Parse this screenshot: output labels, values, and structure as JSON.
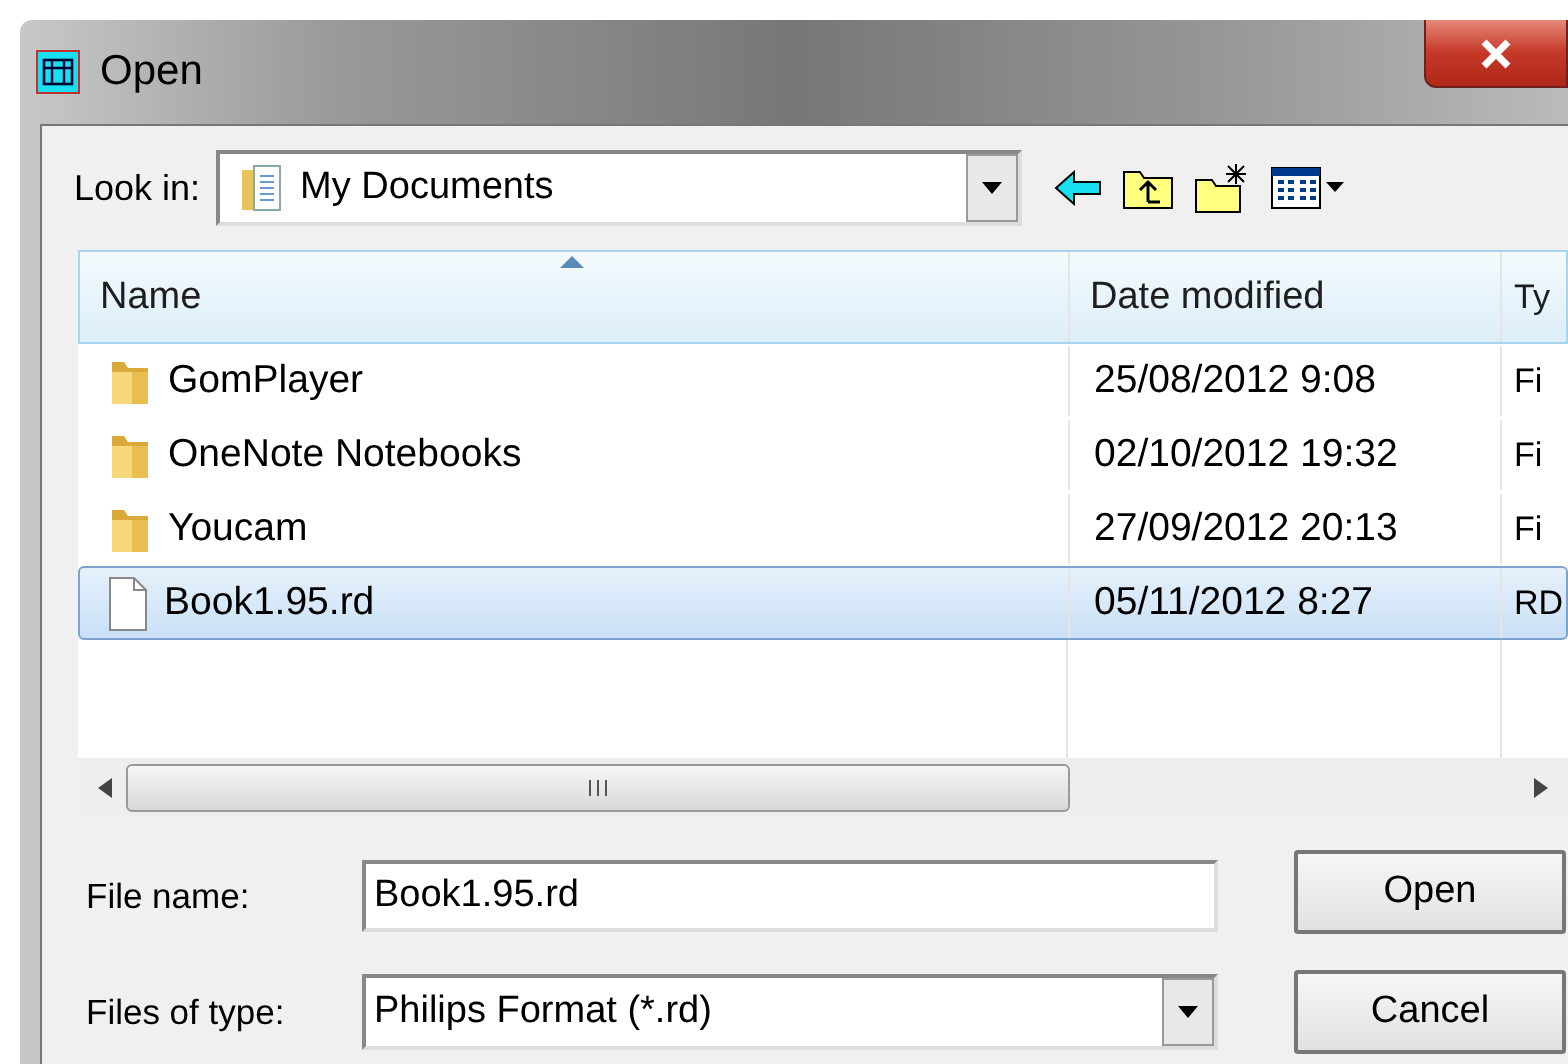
{
  "window": {
    "title": "Open"
  },
  "look_in": {
    "label": "Look in:",
    "value": "My Documents"
  },
  "table": {
    "columns": [
      "Name",
      "Date modified",
      "Ty"
    ],
    "rows": [
      {
        "kind": "folder",
        "name": "GomPlayer",
        "date": "25/08/2012 9:08",
        "column_3": "Fi",
        "selected": false
      },
      {
        "kind": "folder",
        "name": "OneNote Notebooks",
        "date": "02/10/2012 19:32",
        "column_3": "Fi",
        "selected": false
      },
      {
        "kind": "folder",
        "name": "Youcam",
        "date": "27/09/2012 20:13",
        "column_3": "Fi",
        "selected": false
      },
      {
        "kind": "file",
        "name": "Book1.95.rd",
        "date": "05/11/2012 8:27",
        "column_3": "RD",
        "selected": true
      }
    ]
  },
  "file_name": {
    "label": "File name:",
    "value": "Book1.95.rd"
  },
  "file_type": {
    "label": "Files of type:",
    "value": "Philips Format (*.rd)"
  },
  "buttons": [
    "Open",
    "Cancel"
  ]
}
